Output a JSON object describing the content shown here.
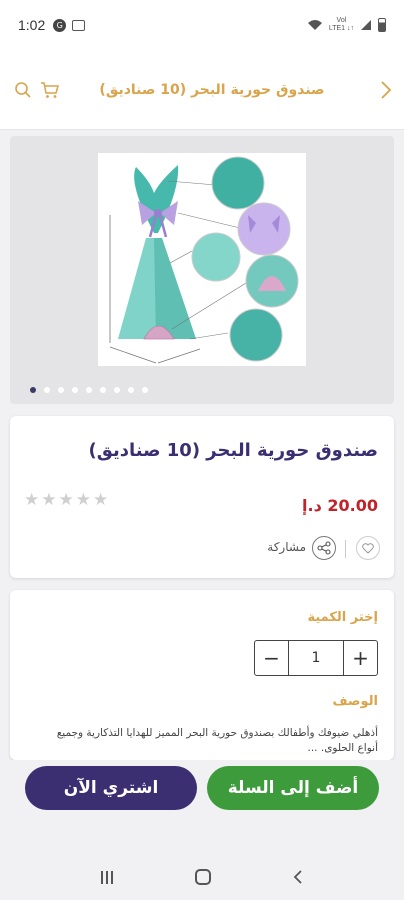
{
  "status": {
    "time": "1:02",
    "notif_letter": "G",
    "signal_text_top": "Vol",
    "signal_text_bottom": "LTE1 ↓↑"
  },
  "header": {
    "title": "صندوق حورية البحر (10 صناديق)",
    "icons": [
      "search-icon",
      "cart-icon",
      "chevron-right-icon"
    ]
  },
  "gallery": {
    "dot_count": 9,
    "active_dot": 0
  },
  "product": {
    "title": "صندوق حورية البحر (10 صناديق)",
    "price": "20.00 د.إ",
    "rating": 0,
    "rating_max": 5,
    "share_label": "مشاركة"
  },
  "quantity": {
    "label": "إختر الكمية",
    "value": "1",
    "minus": "−",
    "plus": "+"
  },
  "description": {
    "label": "الوصف",
    "text": "أذهلي ضيوفك وأطفالك بصندوق حورية البحر المميز للهدايا التذكارية وجميع أنواع الحلوى. ..."
  },
  "actions": {
    "buy_now": "اشتري الآن",
    "add_to_cart": "أضف إلى السلة"
  },
  "colors": {
    "accent_gold": "#d9a44b",
    "brand_purple": "#3b2f72",
    "cart_green": "#3e9b3c",
    "price_red": "#c0242a"
  }
}
